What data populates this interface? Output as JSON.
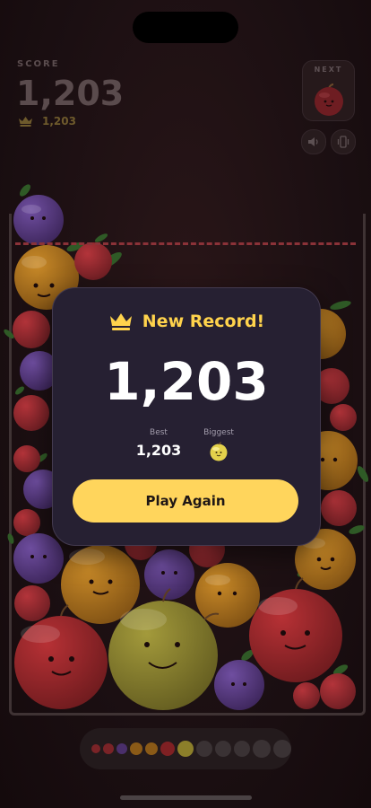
{
  "header": {
    "score_label": "SCORE",
    "score_value": "1,203",
    "best_score": "1,203",
    "next_label": "NEXT",
    "next_fruit": "cherry"
  },
  "controls": {
    "sound_icon": "speaker-icon",
    "vibration_icon": "vibrate-icon"
  },
  "modal": {
    "title": "New Record!",
    "score": "1,203",
    "best_label": "Best",
    "best_value": "1,203",
    "biggest_label": "Biggest",
    "biggest_fruit": "lemon",
    "play_again_label": "Play Again"
  },
  "evolution": [
    "cherry",
    "cherry",
    "grape",
    "orange",
    "orange",
    "apple",
    "lemon",
    "locked",
    "locked",
    "locked",
    "locked",
    "locked"
  ],
  "colors": {
    "accent": "#ffd55c",
    "record_title": "#ffd34c",
    "danger_line": "#8b3238",
    "cherry": "#d8383f",
    "grape": "#7d4fb5",
    "orange": "#f2a11c",
    "apple": "#e23b37",
    "lemon": "#e8d344"
  }
}
